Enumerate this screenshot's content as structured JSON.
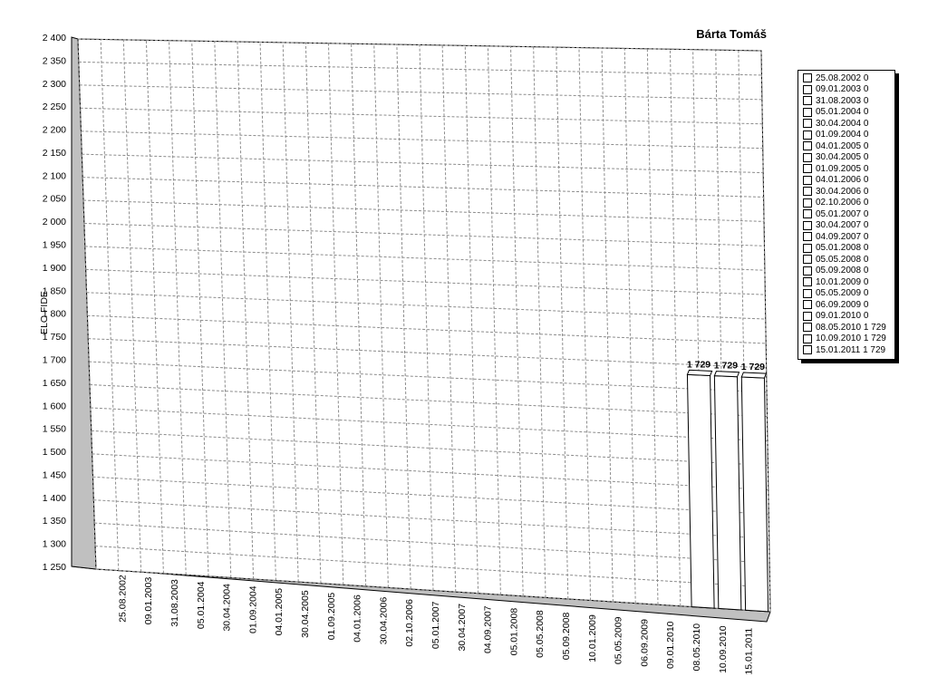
{
  "chart_data": {
    "type": "bar",
    "title": "Bárta Tomáš",
    "ylabel": "ELO FIDE",
    "xlabel": "",
    "ylim": [
      1250,
      2400
    ],
    "y_ticks": [
      "1 250",
      "1 300",
      "1 350",
      "1 400",
      "1 450",
      "1 500",
      "1 550",
      "1 600",
      "1 650",
      "1 700",
      "1 750",
      "1 800",
      "1 850",
      "1 900",
      "1 950",
      "2 000",
      "2 050",
      "2 100",
      "2 150",
      "2 200",
      "2 250",
      "2 300",
      "2 350",
      "2 400"
    ],
    "categories": [
      "25.08.2002",
      "09.01.2003",
      "31.08.2003",
      "05.01.2004",
      "30.04.2004",
      "01.09.2004",
      "04.01.2005",
      "30.04.2005",
      "01.09.2005",
      "04.01.2006",
      "30.04.2006",
      "02.10.2006",
      "05.01.2007",
      "30.04.2007",
      "04.09.2007",
      "05.01.2008",
      "05.05.2008",
      "05.09.2008",
      "10.01.2009",
      "05.05.2009",
      "06.09.2009",
      "09.01.2010",
      "08.05.2010",
      "10.09.2010",
      "15.01.2011"
    ],
    "values": [
      0,
      0,
      0,
      0,
      0,
      0,
      0,
      0,
      0,
      0,
      0,
      0,
      0,
      0,
      0,
      0,
      0,
      0,
      0,
      0,
      0,
      0,
      1729,
      1729,
      1729
    ],
    "data_labels": [
      "1 729",
      "1 729",
      "1 729"
    ],
    "grid": true,
    "legend_position": "right",
    "legend": [
      "25.08.2002 0",
      "09.01.2003 0",
      "31.08.2003 0",
      "05.01.2004 0",
      "30.04.2004 0",
      "01.09.2004 0",
      "04.01.2005 0",
      "30.04.2005 0",
      "01.09.2005 0",
      "04.01.2006 0",
      "30.04.2006 0",
      "02.10.2006 0",
      "05.01.2007 0",
      "30.04.2007 0",
      "04.09.2007 0",
      "05.01.2008 0",
      "05.05.2008 0",
      "05.09.2008 0",
      "10.01.2009 0",
      "05.05.2009 0",
      "06.09.2009 0",
      "09.01.2010 0",
      "08.05.2010 1 729",
      "10.09.2010 1 729",
      "15.01.2011 1 729"
    ],
    "colors": {
      "bar_fill": "#ffffff",
      "line": "#000000",
      "grid": "#8c8c8c",
      "floor": "#c0c0c0"
    }
  }
}
